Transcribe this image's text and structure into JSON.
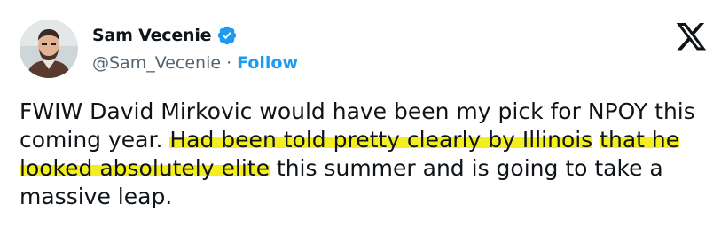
{
  "tweet": {
    "author": {
      "display_name": "Sam Vecenie",
      "handle": "@Sam_Vecenie",
      "verified": true,
      "verified_icon": "verified-badge-icon",
      "avatar_icon": "avatar-photo"
    },
    "separator": "·",
    "follow_label": "Follow",
    "platform_icon": "x-logo-icon",
    "text_before": "FWIW David Mirkovic would have been my pick for NPOY this coming year. ",
    "text_highlight_1": "Had been told pretty clearly by Illinois",
    "text_space": " ",
    "text_highlight_2": "that he looked absolutely elite",
    "text_after": " this summer and is going to take a massive leap."
  },
  "colors": {
    "link": "#1d9bf0",
    "secondary_text": "#536471",
    "highlight": "#f5ee1f",
    "text": "#0f1419"
  }
}
